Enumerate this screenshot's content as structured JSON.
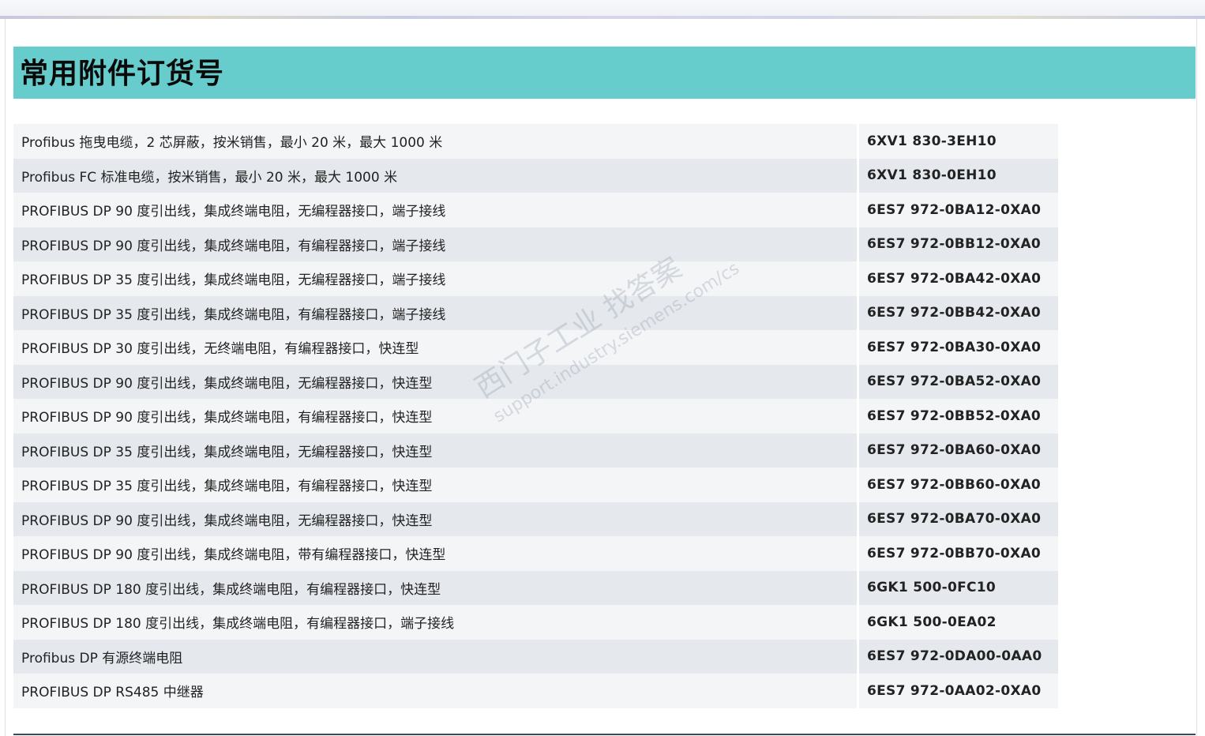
{
  "title": "常用附件订货号",
  "watermark": {
    "line1": "西门子工业 找答案",
    "line2": "support.industry.siemens.com/cs"
  },
  "rows": [
    {
      "desc": "Profibus 拖曳电缆，2 芯屏蔽，按米销售，最小 20 米，最大 1000 米",
      "code": "6XV1 830-3EH10"
    },
    {
      "desc": "Profibus FC 标准电缆，按米销售，最小 20 米，最大 1000 米",
      "code": "6XV1 830-0EH10"
    },
    {
      "desc": "PROFIBUS DP 90 度引出线，集成终端电阻，无编程器接口，端子接线",
      "code": "6ES7 972-0BA12-0XA0"
    },
    {
      "desc": "PROFIBUS DP 90 度引出线，集成终端电阻，有编程器接口，端子接线",
      "code": "6ES7 972-0BB12-0XA0"
    },
    {
      "desc": "PROFIBUS DP 35 度引出线，集成终端电阻，无编程器接口，端子接线",
      "code": "6ES7 972-0BA42-0XA0"
    },
    {
      "desc": "PROFIBUS DP 35 度引出线，集成终端电阻，有编程器接口，端子接线",
      "code": "6ES7 972-0BB42-0XA0"
    },
    {
      "desc": "PROFIBUS DP 30 度引出线，无终端电阻，有编程器接口，快连型",
      "code": "6ES7 972-0BA30-0XA0"
    },
    {
      "desc": "PROFIBUS DP 90 度引出线，集成终端电阻，无编程器接口，快连型",
      "code": "6ES7 972-0BA52-0XA0"
    },
    {
      "desc": "PROFIBUS DP 90 度引出线，集成终端电阻，有编程器接口，快连型",
      "code": "6ES7 972-0BB52-0XA0"
    },
    {
      "desc": "PROFIBUS DP 35 度引出线，集成终端电阻，无编程器接口，快连型",
      "code": "6ES7 972-0BA60-0XA0"
    },
    {
      "desc": "PROFIBUS DP 35 度引出线，集成终端电阻，有编程器接口，快连型",
      "code": "6ES7 972-0BB60-0XA0"
    },
    {
      "desc": "PROFIBUS DP 90 度引出线，集成终端电阻，无编程器接口，快连型",
      "code": "6ES7 972-0BA70-0XA0"
    },
    {
      "desc": "PROFIBUS DP 90 度引出线，集成终端电阻，带有编程器接口，快连型",
      "code": "6ES7 972-0BB70-0XA0"
    },
    {
      "desc": "PROFIBUS DP 180 度引出线，集成终端电阻，有编程器接口，快连型",
      "code": "6GK1 500-0FC10"
    },
    {
      "desc": "PROFIBUS DP 180 度引出线，集成终端电阻，有编程器接口，端子接线",
      "code": "6GK1 500-0EA02"
    },
    {
      "desc": "Profibus DP 有源终端电阻",
      "code": "6ES7 972-0DA00-0AA0"
    },
    {
      "desc": "PROFIBUS DP RS485 中继器",
      "code": "6ES7 972-0AA02-0XA0"
    }
  ]
}
